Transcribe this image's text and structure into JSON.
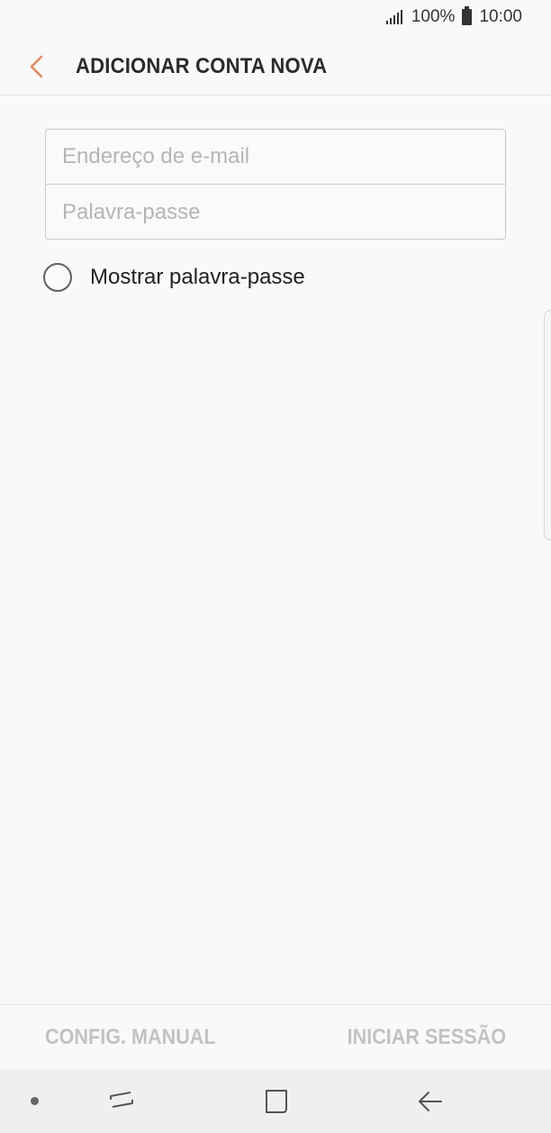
{
  "status_bar": {
    "battery_percent": "100%",
    "time": "10:00"
  },
  "app_bar": {
    "back_icon": "chevron-left-icon",
    "title": "ADICIONAR CONTA NOVA"
  },
  "form": {
    "email": {
      "value": "",
      "placeholder": "Endereço de e-mail"
    },
    "password": {
      "value": "",
      "placeholder": "Palavra-passe"
    },
    "show_password_label": "Mostrar palavra-passe",
    "show_password_checked": false
  },
  "bottom_actions": {
    "manual_setup_label": "CONFIG. MANUAL",
    "sign_in_label": "INICIAR SESSÃO"
  },
  "colors": {
    "accent": "#e8875a",
    "disabled_action": "#c2c2c2"
  }
}
